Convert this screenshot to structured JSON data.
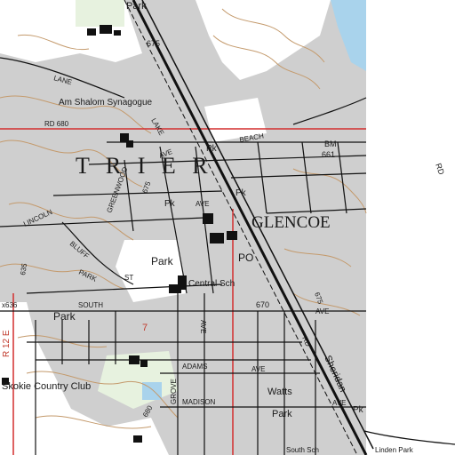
{
  "map": {
    "colors": {
      "urban_tint": "#cfcfcf",
      "white_area": "#ffffff",
      "water": "#a9d3ec",
      "contour": "#c49a6c",
      "road": "#111111",
      "grid_red": "#d32f2f",
      "vegetation": "#cfe8c0"
    },
    "labels": {
      "park_top": "Park",
      "num_675": "675",
      "lane": "LANE",
      "synagogue": "Am Shalom Synagogue",
      "rd_680": "RD   680",
      "lake": "LAKE",
      "pk_1": "Pk",
      "beach": "BEACH",
      "bm": "BM",
      "num_661": "661",
      "trier": "T  R  I  E  R",
      "ave_1": "AVE",
      "rd_right": "RD",
      "rd_right2": "RD",
      "pk_2": "Pk",
      "greenwood": "GREENWOOD",
      "num_675_b": "675",
      "pk_3": "Pk",
      "ave_2": "AVE",
      "glencoe": "GLENCOE",
      "lincoln": "LINCOLN",
      "bluff": "BLUFF",
      "park_mid": "Park",
      "po": "PO",
      "num_635": "635",
      "park_word": "PARK",
      "central_sch": "Central Sch",
      "x636": "x636",
      "south": "SOUTH",
      "num_670": "670",
      "ave_3": "AVE",
      "park_lower": "Park",
      "seven": "7",
      "r12e": "R 12 E",
      "adams": "ADAMS",
      "ave_4": "AVE",
      "grove": "GROVE",
      "skokie": "Skokie Country Club",
      "watts": "Watts",
      "watts_park": "Park",
      "madison": "MADISON",
      "num_680": "680",
      "ave_5": "AVE",
      "pk_4": "Pk",
      "south_sch": "South Sch",
      "sheridan": "Sheridan",
      "linden": "Linden Park",
      "rd_lower": "RD",
      "ave_mid": "AVE",
      "num_675_c": "675",
      "ave_6": "AVE",
      "st_1": "ST"
    }
  }
}
